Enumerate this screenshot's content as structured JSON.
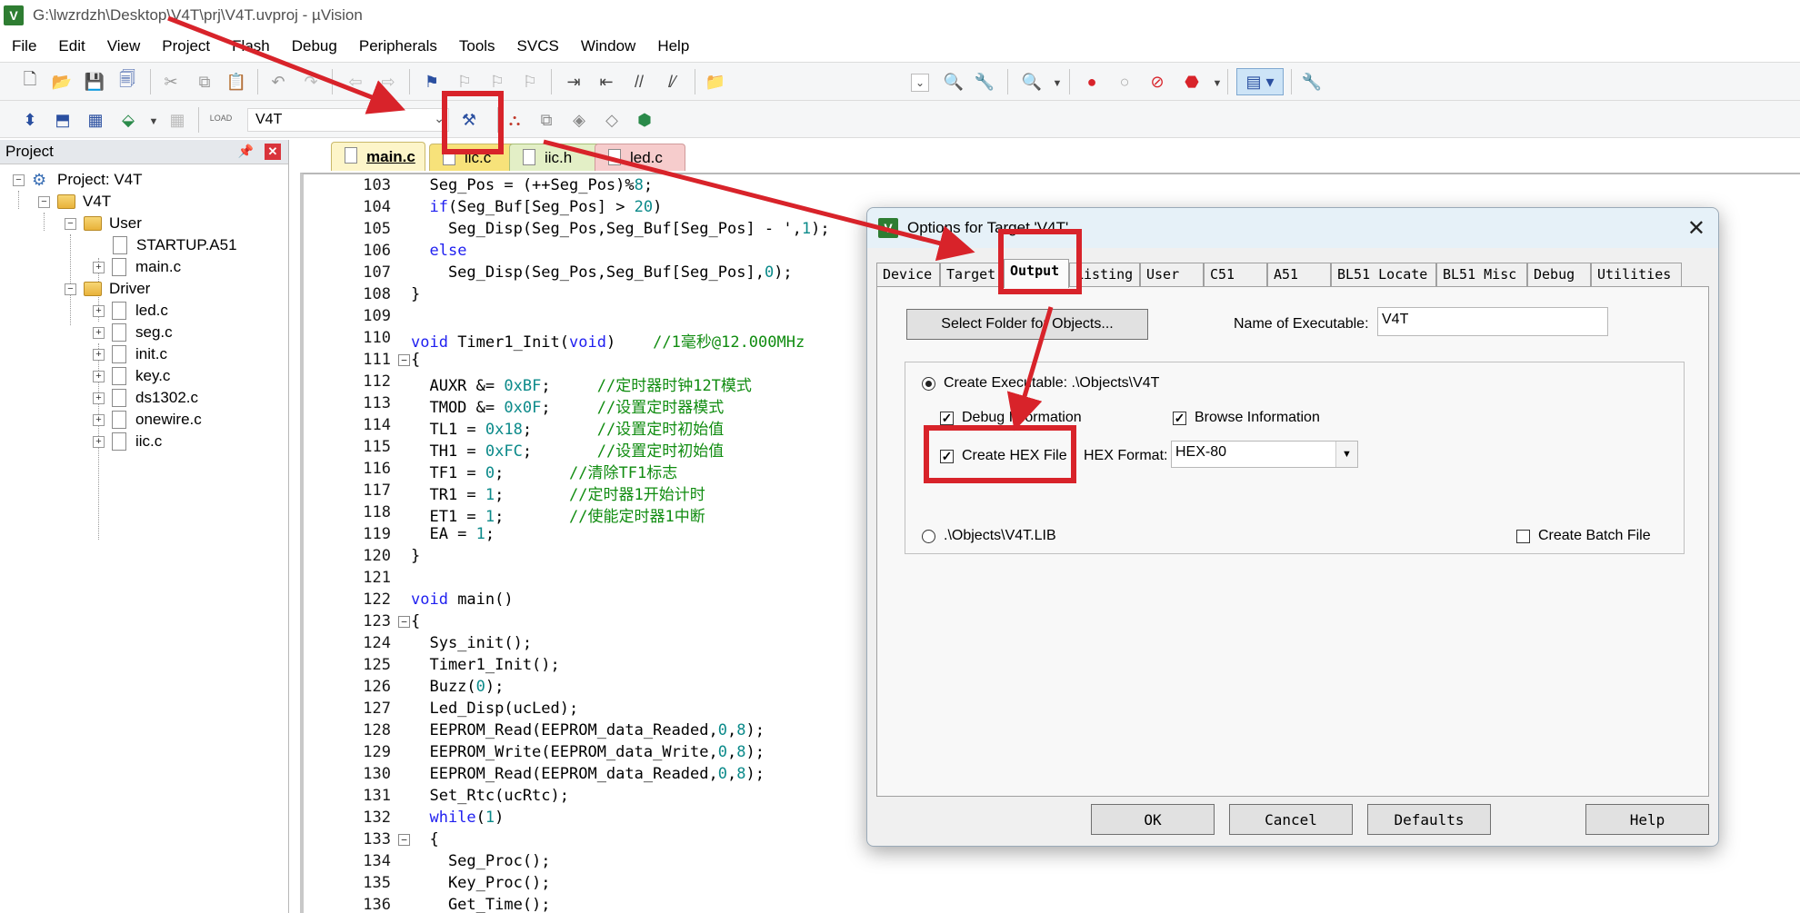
{
  "window": {
    "title": "G:\\lwzrdzh\\Desktop\\V4T\\prj\\V4T.uvproj - µVision",
    "app_icon": "V"
  },
  "menu": [
    "File",
    "Edit",
    "View",
    "Project",
    "Flash",
    "Debug",
    "Peripherals",
    "Tools",
    "SVCS",
    "Window",
    "Help"
  ],
  "toolbar2": {
    "target": "V4T",
    "load_label": "LOAD"
  },
  "project_panel": {
    "title": "Project",
    "root": "Project: V4T",
    "target": "V4T",
    "groups": [
      {
        "name": "User",
        "files": [
          "STARTUP.A51",
          "main.c"
        ]
      },
      {
        "name": "Driver",
        "files": [
          "led.c",
          "seg.c",
          "init.c",
          "key.c",
          "ds1302.c",
          "onewire.c",
          "iic.c"
        ]
      }
    ]
  },
  "editor_tabs": [
    "main.c",
    "iic.c",
    "iic.h",
    "led.c"
  ],
  "code": {
    "lines": [
      {
        "n": "103",
        "text": "  Seg_Pos = (++Seg_Pos)%8;"
      },
      {
        "n": "104",
        "text": "  if(Seg_Buf[Seg_Pos] > 20)"
      },
      {
        "n": "105",
        "text": "    Seg_Disp(Seg_Pos,Seg_Buf[Seg_Pos] - ',1);"
      },
      {
        "n": "106",
        "text": "  else"
      },
      {
        "n": "107",
        "text": "    Seg_Disp(Seg_Pos,Seg_Buf[Seg_Pos],0);"
      },
      {
        "n": "108",
        "text": "}"
      },
      {
        "n": "109",
        "text": ""
      },
      {
        "n": "110",
        "text": "void Timer1_Init(void)    //1毫秒@12.000MHz"
      },
      {
        "n": "111",
        "text": "{"
      },
      {
        "n": "112",
        "text": "  AUXR &= 0xBF;     //定时器时钟12T模式"
      },
      {
        "n": "113",
        "text": "  TMOD &= 0x0F;     //设置定时器模式"
      },
      {
        "n": "114",
        "text": "  TL1 = 0x18;       //设置定时初始值"
      },
      {
        "n": "115",
        "text": "  TH1 = 0xFC;       //设置定时初始值"
      },
      {
        "n": "116",
        "text": "  TF1 = 0;       //清除TF1标志"
      },
      {
        "n": "117",
        "text": "  TR1 = 1;       //定时器1开始计时"
      },
      {
        "n": "118",
        "text": "  ET1 = 1;       //使能定时器1中断"
      },
      {
        "n": "119",
        "text": "  EA = 1;"
      },
      {
        "n": "120",
        "text": "}"
      },
      {
        "n": "121",
        "text": ""
      },
      {
        "n": "122",
        "text": "void main()"
      },
      {
        "n": "123",
        "text": "{"
      },
      {
        "n": "124",
        "text": "  Sys_init();"
      },
      {
        "n": "125",
        "text": "  Timer1_Init();"
      },
      {
        "n": "126",
        "text": "  Buzz(0);"
      },
      {
        "n": "127",
        "text": "  Led_Disp(ucLed);"
      },
      {
        "n": "128",
        "text": "  EEPROM_Read(EEPROM_data_Readed,0,8);"
      },
      {
        "n": "129",
        "text": "  EEPROM_Write(EEPROM_data_Write,0,8);"
      },
      {
        "n": "130",
        "text": "  EEPROM_Read(EEPROM_data_Readed,0,8);"
      },
      {
        "n": "131",
        "text": "  Set_Rtc(ucRtc);"
      },
      {
        "n": "132",
        "text": "  while(1)"
      },
      {
        "n": "133",
        "text": "  {"
      },
      {
        "n": "134",
        "text": "    Seg_Proc();"
      },
      {
        "n": "135",
        "text": "    Key_Proc();"
      },
      {
        "n": "136",
        "text": "    Get_Time();"
      }
    ]
  },
  "dialog": {
    "title": "Options for Target 'V4T'",
    "tabs": [
      "Device",
      "Target",
      "Output",
      "Listing",
      "User",
      "C51",
      "A51",
      "BL51 Locate",
      "BL51 Misc",
      "Debug",
      "Utilities"
    ],
    "active_tab": "Output",
    "select_folder_label": "Select Folder for Objects...",
    "name_exe_label": "Name of Executable:",
    "name_exe_value": "V4T",
    "create_exe_label": "Create Executable:  .\\Objects\\V4T",
    "debug_info_label": "Debug Information",
    "browse_info_label": "Browse Information",
    "create_hex_label": "Create HEX File",
    "hex_format_label": "HEX Format:",
    "hex_format_value": "HEX-80",
    "lib_label": ".\\Objects\\V4T.LIB",
    "batch_label": "Create Batch File",
    "buttons": {
      "ok": "OK",
      "cancel": "Cancel",
      "defaults": "Defaults",
      "help": "Help"
    }
  },
  "colors": {
    "annotation": "#d8232a",
    "keyword": "#1f1ff0",
    "number": "#0b8a8a",
    "comment": "#108c10"
  }
}
